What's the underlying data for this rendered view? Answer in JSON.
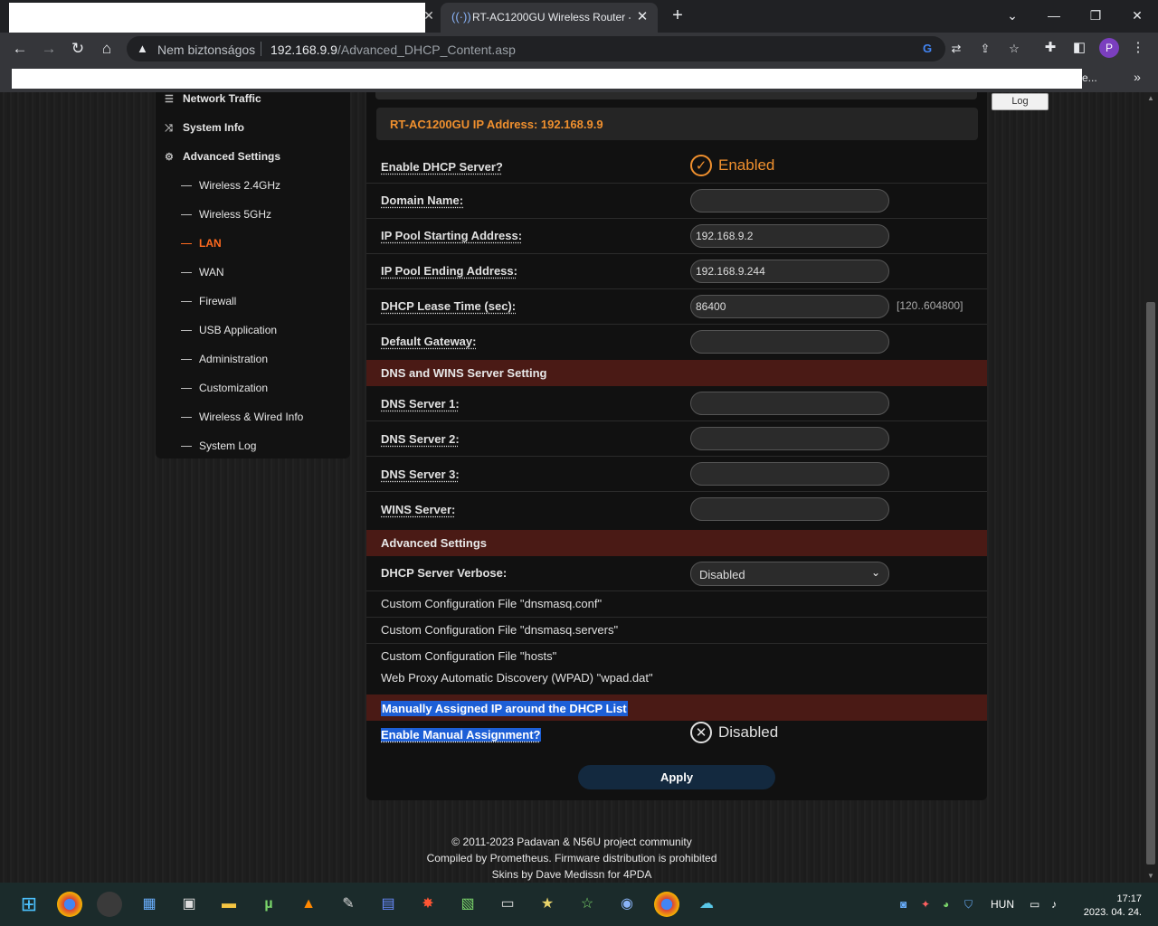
{
  "browser": {
    "tab_title": "RT-AC1200GU Wireless Router - ",
    "insecure_label": "Nem biztonságos",
    "url_host": "192.168.9.9",
    "url_path": "/Advanced_DHCP_Content.asp",
    "profile_letter": "P",
    "bookmark_ellipsis": "e..."
  },
  "sidebar": {
    "top_items": [
      {
        "label": "Network Traffic",
        "icon": "list-icon"
      },
      {
        "label": "System Info",
        "icon": "shuffle-icon"
      },
      {
        "label": "Advanced Settings",
        "icon": "gear-icon"
      }
    ],
    "sub_items": [
      "Wireless 2.4GHz",
      "Wireless 5GHz",
      "LAN",
      "WAN",
      "Firewall",
      "USB Application",
      "Administration",
      "Customization",
      "Wireless & Wired Info",
      "System Log"
    ],
    "active": "LAN"
  },
  "log_button": "Log",
  "panel": {
    "ip_address_label": "RT-AC1200GU IP Address: 192.168.9.9",
    "enable_dhcp": {
      "label": "Enable DHCP Server?",
      "state": "Enabled"
    },
    "domain_name": {
      "label": "Domain Name:",
      "value": ""
    },
    "pool_start": {
      "label": "IP Pool Starting Address:",
      "value": "192.168.9.2"
    },
    "pool_end": {
      "label": "IP Pool Ending Address:",
      "value": "192.168.9.244"
    },
    "lease_time": {
      "label": "DHCP Lease Time (sec):",
      "value": "86400",
      "hint": "[120..604800]"
    },
    "gateway": {
      "label": "Default Gateway:",
      "value": ""
    },
    "dns_section": "DNS and WINS Server Setting",
    "dns1": {
      "label": "DNS Server 1:",
      "value": ""
    },
    "dns2": {
      "label": "DNS Server 2:",
      "value": ""
    },
    "dns3": {
      "label": "DNS Server 3:",
      "value": ""
    },
    "wins": {
      "label": "WINS Server:",
      "value": ""
    },
    "advanced_section": "Advanced Settings",
    "verbose": {
      "label": "DHCP Server Verbose:",
      "value": "Disabled"
    },
    "custom_files": [
      "Custom Configuration File \"dnsmasq.conf\"",
      "Custom Configuration File \"dnsmasq.servers\"",
      "Custom Configuration File \"hosts\"",
      "Web Proxy Automatic Discovery (WPAD) \"wpad.dat\""
    ],
    "manual_section": "Manually Assigned IP around the DHCP List",
    "manual_assign": {
      "label": "Enable Manual Assignment?",
      "state": "Disabled"
    },
    "apply": "Apply"
  },
  "footer": [
    "© 2011-2023 Padavan & N56U project community",
    "Compiled by Prometheus. Firmware distribution is prohibited",
    "Skins by Dave Medissn for 4PDA"
  ],
  "taskbar": {
    "language": "HUN",
    "time": "17:17",
    "date": "2023. 04. 24."
  },
  "colors": {
    "accent_orange": "#f0902e",
    "lan_active": "#ff6a1f",
    "section_bg": "#4a1a15",
    "apply_bg": "#13293f"
  }
}
